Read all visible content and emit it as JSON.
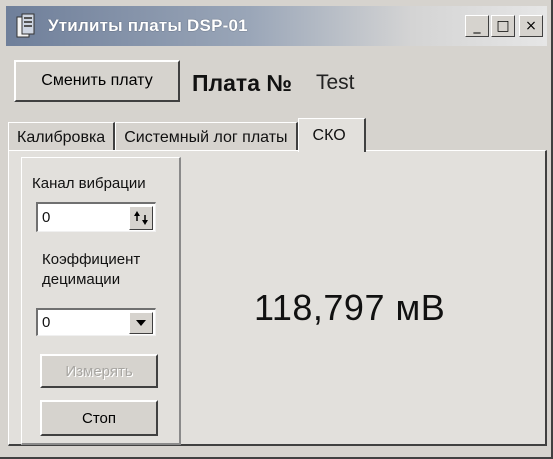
{
  "window": {
    "title": "Утилиты платы DSP-01",
    "controls": {
      "minimize": "_",
      "maximize": "□",
      "close": "×"
    }
  },
  "header": {
    "change_board_label": "Сменить плату",
    "board_label": "Плата №",
    "board_name": "Test"
  },
  "tabs": [
    {
      "label": "Калибровка"
    },
    {
      "label": "Системный лог платы"
    },
    {
      "label": "СКО"
    }
  ],
  "panel": {
    "vibration_channel_label": "Канал вибрации",
    "vibration_channel_value": "0",
    "decimation_label_line1": "Коэффициент",
    "decimation_label_line2": "децимации",
    "decimation_value": "0",
    "measure_label": "Измерять",
    "stop_label": "Стоп",
    "measurement_value": "118,797 мВ"
  }
}
